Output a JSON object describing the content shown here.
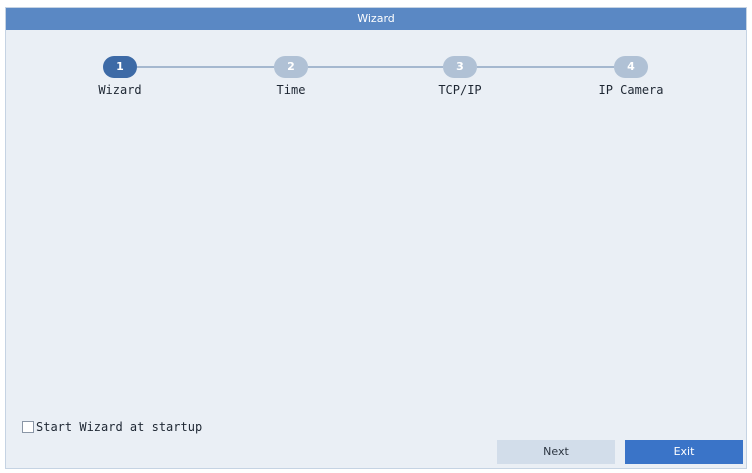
{
  "window": {
    "title": "Wizard"
  },
  "steps": [
    {
      "number": "1",
      "label": "Wizard",
      "active": true
    },
    {
      "number": "2",
      "label": "Time",
      "active": false
    },
    {
      "number": "3",
      "label": "TCP/IP",
      "active": false
    },
    {
      "number": "4",
      "label": "IP Camera",
      "active": false
    }
  ],
  "startup_option": {
    "label": "Start Wizard at startup",
    "checked": false
  },
  "buttons": {
    "next_label": "Next",
    "exit_label": "Exit"
  },
  "colors": {
    "titlebar": "#5a88c4",
    "active_step": "#3d6aa6",
    "inactive_step": "#b0c1d5",
    "exit_button": "#3a74c8",
    "background": "#eaeff5"
  }
}
